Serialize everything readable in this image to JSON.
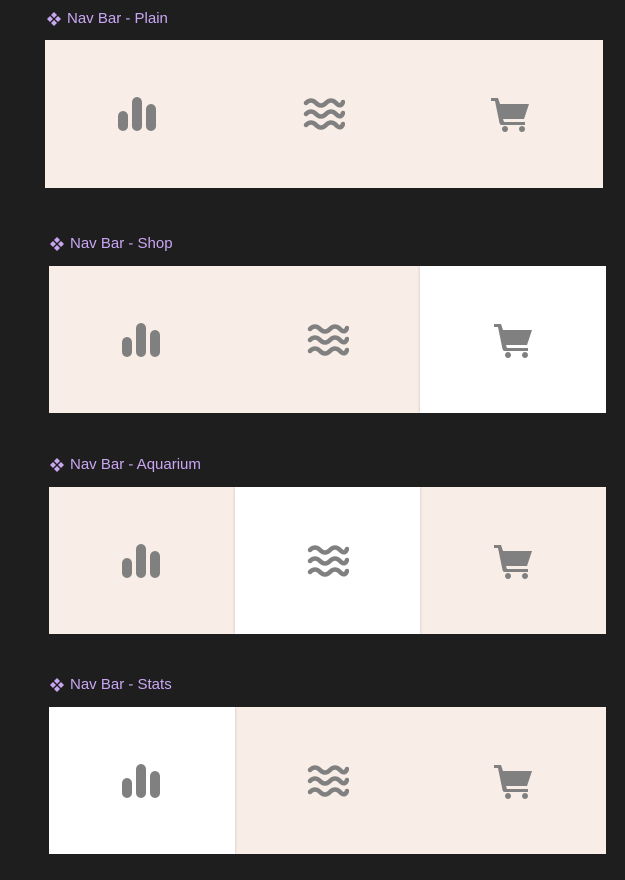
{
  "colors": {
    "background": "#1e1e1e",
    "label": "#c9a6f2",
    "bar": "#f8ede7",
    "active": "#ffffff",
    "icon": "#808080"
  },
  "frames": [
    {
      "label": "Nav Bar - Plain",
      "active": null,
      "items": [
        "bar-chart-icon",
        "waves-icon",
        "shopping-cart-icon"
      ]
    },
    {
      "label": "Nav Bar - Shop",
      "active": 2,
      "items": [
        "bar-chart-icon",
        "waves-icon",
        "shopping-cart-icon"
      ]
    },
    {
      "label": "Nav Bar - Aquarium",
      "active": 1,
      "items": [
        "bar-chart-icon",
        "waves-icon",
        "shopping-cart-icon"
      ]
    },
    {
      "label": "Nav Bar - Stats",
      "active": 0,
      "items": [
        "bar-chart-icon",
        "waves-icon",
        "shopping-cart-icon"
      ]
    }
  ]
}
